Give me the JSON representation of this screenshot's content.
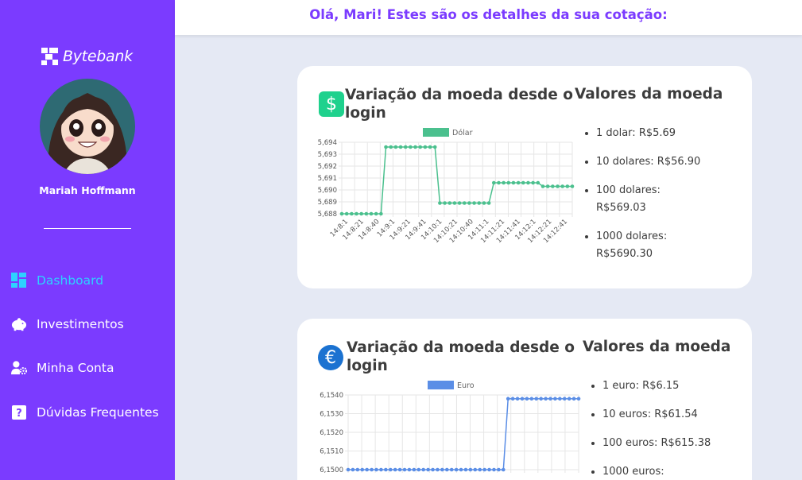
{
  "header": {
    "greeting": "Olá, Mari! Estes são os detalhes da sua cotação:"
  },
  "sidebar": {
    "brand": "Bytebank",
    "user_name": "Mariah Hoffmann",
    "items": [
      {
        "label": "Dashboard",
        "icon": "dashboard-icon",
        "active": true
      },
      {
        "label": "Investimentos",
        "icon": "piggy-bank-icon",
        "active": false
      },
      {
        "label": "Minha Conta",
        "icon": "user-gear-icon",
        "active": false
      },
      {
        "label": "Dúvidas Frequentes",
        "icon": "question-icon",
        "active": false
      }
    ]
  },
  "cards": [
    {
      "title": "Variação da moeda desde o login",
      "icon": "dollar-icon",
      "icon_glyph": "$",
      "icon_color": "#1fd18d",
      "values_title": "Valores da moeda",
      "values": [
        "1 dolar: R$5.69",
        "10 dolares: R$56.90",
        "100 dolares: R$569.03",
        "1000 dolares: R$5690.30"
      ]
    },
    {
      "title": "Variação da moeda desde o login",
      "icon": "euro-icon",
      "icon_glyph": "€",
      "icon_color": "#1b72d1",
      "values_title": "Valores da moeda",
      "values": [
        "1 euro: R$6.15",
        "10 euros: R$61.54",
        "100 euros: R$615.38",
        "1000 euros:"
      ]
    }
  ],
  "chart_data": [
    {
      "type": "line",
      "color": "#4bc08e",
      "series": [
        {
          "name": "Dólar",
          "values": [
            5.688,
            5.688,
            5.688,
            5.688,
            5.688,
            5.688,
            5.688,
            5.688,
            5.688,
            5.6936,
            5.6936,
            5.6936,
            5.6936,
            5.6936,
            5.6936,
            5.6936,
            5.6936,
            5.6936,
            5.6936,
            5.6936,
            5.6889,
            5.6889,
            5.6889,
            5.6889,
            5.6889,
            5.6889,
            5.6889,
            5.6889,
            5.6889,
            5.6889,
            5.6889,
            5.6906,
            5.6906,
            5.6906,
            5.6906,
            5.6906,
            5.6906,
            5.6906,
            5.6906,
            5.6906,
            5.6906,
            5.6903,
            5.6903,
            5.6903,
            5.6903,
            5.6903,
            5.6903,
            5.6903
          ]
        }
      ],
      "x_labels": [
        "14:8:1",
        "14:8:21",
        "14:8:40",
        "14:9:1",
        "14:9:21",
        "14:9:41",
        "14:10:1",
        "14:10:21",
        "14:10:40",
        "14:11:1",
        "14:11:21",
        "14:11:41",
        "14:12:1",
        "14:12:21",
        "14:12:41"
      ],
      "y_ticks": [
        "5,694",
        "5,693",
        "5,692",
        "5,691",
        "5,690",
        "5,689",
        "5,688"
      ],
      "ylim": [
        5.688,
        5.694
      ],
      "grid": true,
      "legend": "top"
    },
    {
      "type": "line",
      "color": "#5b8ee6",
      "series": [
        {
          "name": "Euro",
          "values": [
            6.15,
            6.15,
            6.15,
            6.15,
            6.15,
            6.15,
            6.15,
            6.15,
            6.15,
            6.15,
            6.15,
            6.15,
            6.15,
            6.15,
            6.15,
            6.15,
            6.15,
            6.15,
            6.15,
            6.15,
            6.15,
            6.15,
            6.15,
            6.15,
            6.15,
            6.15,
            6.15,
            6.15,
            6.15,
            6.15,
            6.15,
            6.15,
            6.15,
            6.15,
            6.1538,
            6.1538,
            6.1538,
            6.1538,
            6.1538,
            6.1538,
            6.1538,
            6.1538,
            6.1538,
            6.1538,
            6.1538,
            6.1538,
            6.1538,
            6.1538,
            6.1538,
            6.1538
          ]
        }
      ],
      "y_ticks": [
        "6,1540",
        "6,1530",
        "6,1520",
        "6,1510",
        "6,1500"
      ],
      "ylim": [
        6.15,
        6.154
      ],
      "grid": true,
      "legend": "top"
    }
  ]
}
